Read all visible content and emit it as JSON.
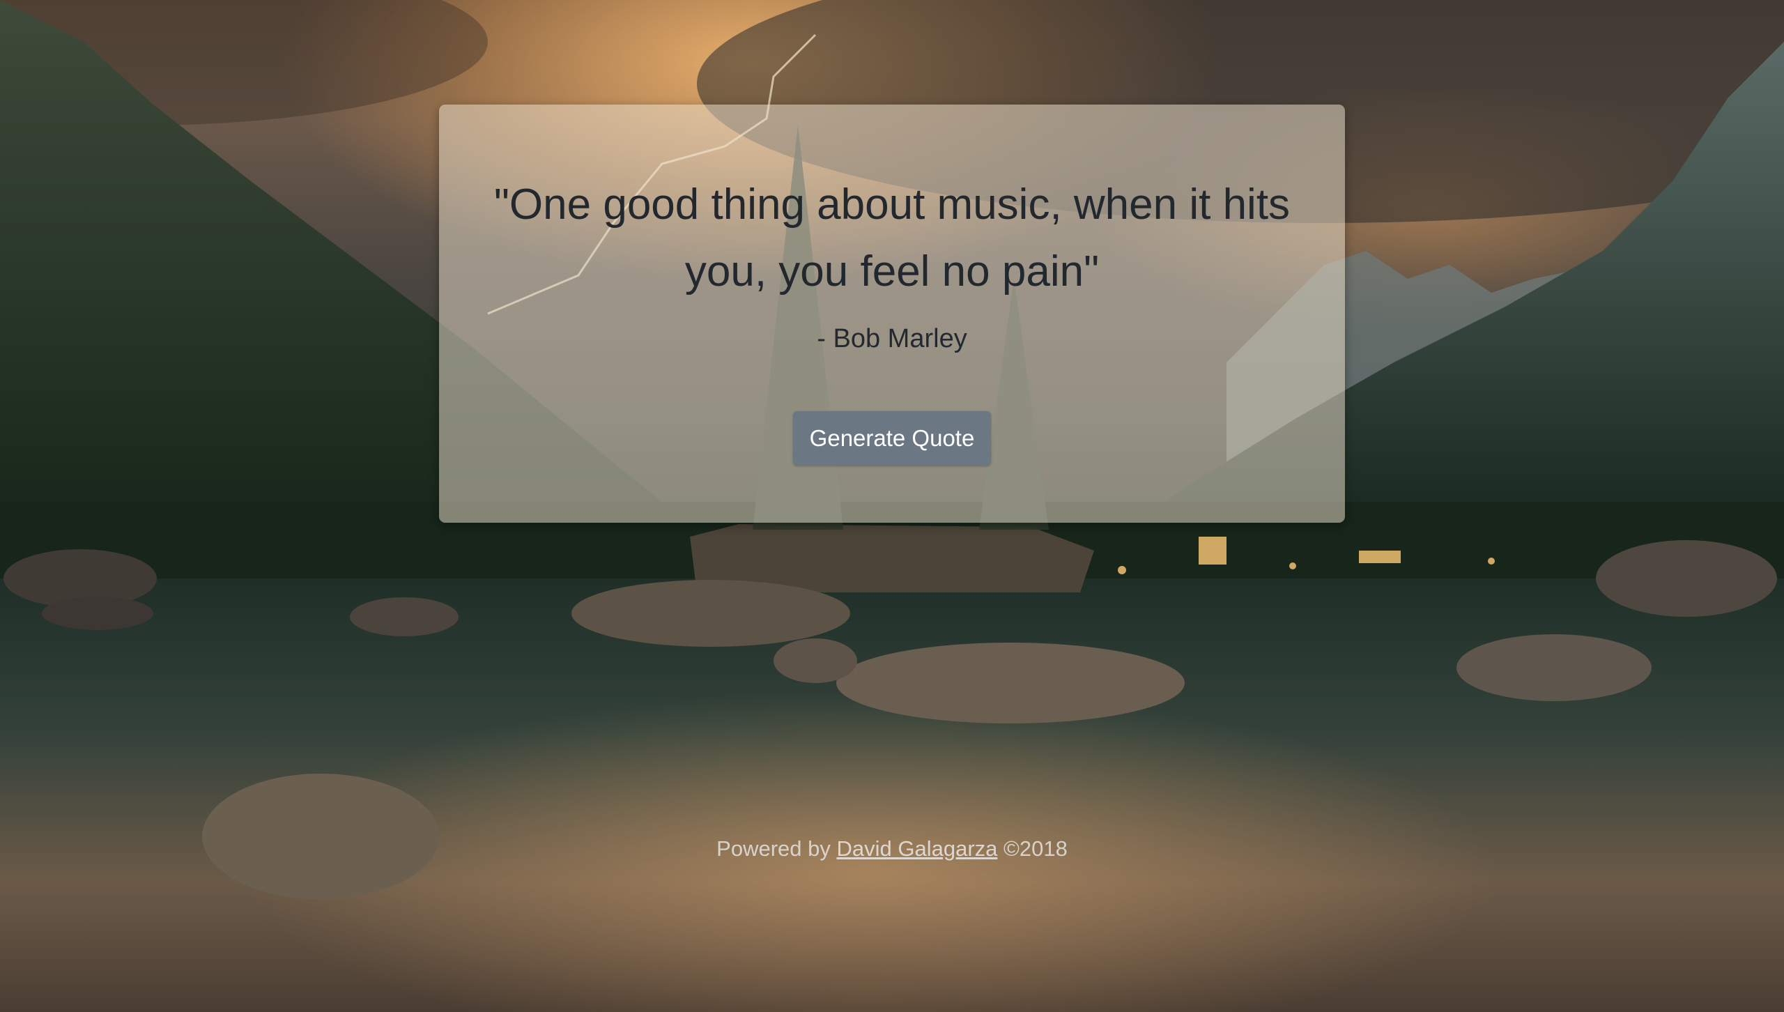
{
  "quote": {
    "text": "\"One good thing about music, when it hits you, you feel no pain\"",
    "author": "- Bob Marley"
  },
  "actions": {
    "generate_label": "Generate Quote"
  },
  "footer": {
    "prefix": "Powered by",
    "author_link": "David Galagarza",
    "suffix": "©2018"
  },
  "background": {
    "description_icon": "mountain-lake-landscape-image"
  },
  "colors": {
    "card_background": "#e9decc",
    "button_background": "#6c7784",
    "quote_text": "#22282e"
  }
}
